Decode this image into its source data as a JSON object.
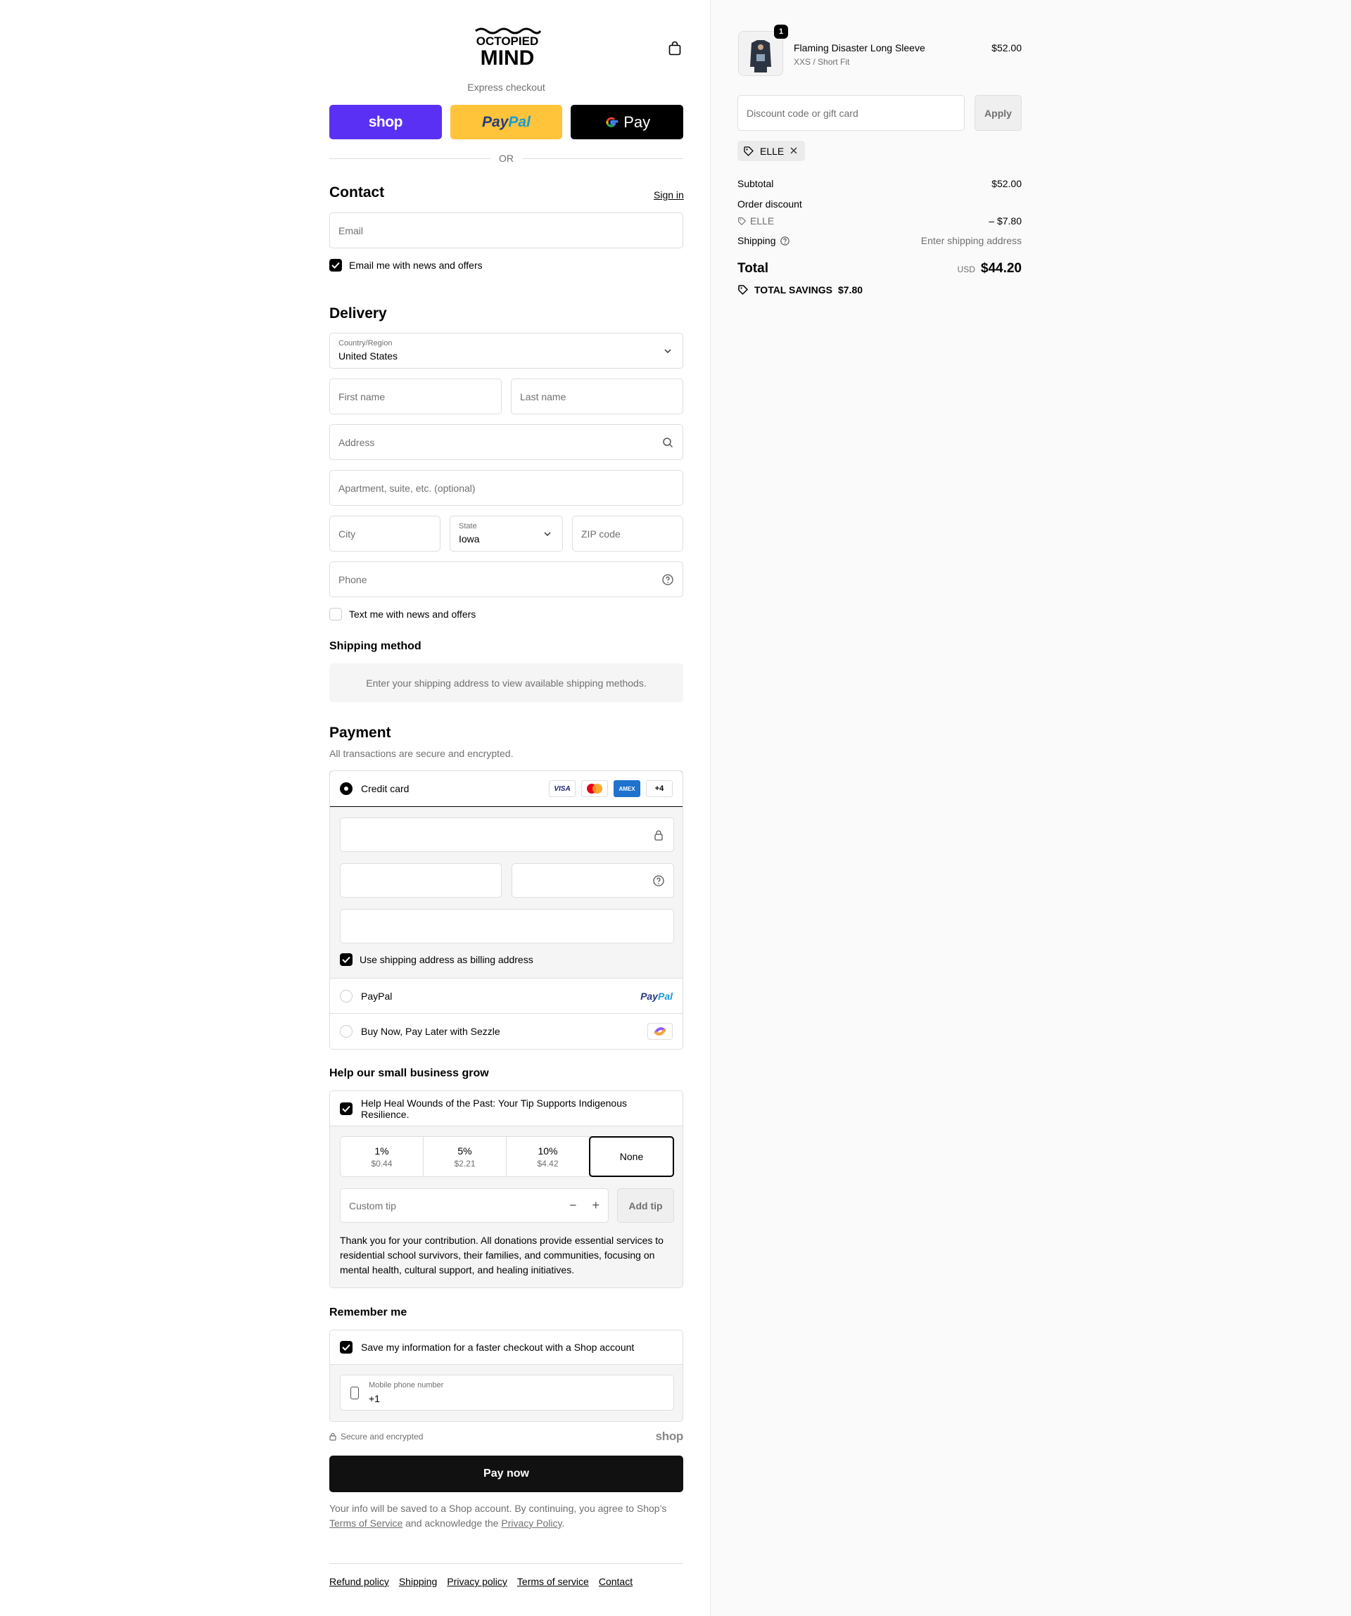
{
  "header": {
    "logo_line1": "OCTOPIED",
    "logo_line2": "MIND",
    "express_label": "Express checkout",
    "express_buttons": {
      "shop": "shop",
      "paypal_1": "Pay",
      "paypal_2": "Pal",
      "gpay": "Pay"
    },
    "or_label": "OR"
  },
  "contact": {
    "title": "Contact",
    "sign_in": "Sign in",
    "email_placeholder": "Email",
    "news_label": "Email me with news and offers",
    "news_checked": true
  },
  "delivery": {
    "title": "Delivery",
    "country_label": "Country/Region",
    "country_value": "United States",
    "first_name_placeholder": "First name",
    "last_name_placeholder": "Last name",
    "address_placeholder": "Address",
    "apartment_placeholder": "Apartment, suite, etc. (optional)",
    "city_placeholder": "City",
    "state_label": "State",
    "state_value": "Iowa",
    "zip_placeholder": "ZIP code",
    "phone_placeholder": "Phone",
    "text_label": "Text me with news and offers",
    "text_checked": false
  },
  "shipping_method": {
    "title": "Shipping method",
    "message": "Enter your shipping address to view available shipping methods."
  },
  "payment": {
    "title": "Payment",
    "subtitle": "All transactions are secure and encrypted.",
    "credit_card_label": "Credit card",
    "card_brands": [
      "VISA",
      "MC",
      "AMEX",
      "+4"
    ],
    "billing_label": "Use shipping address as billing address",
    "billing_checked": true,
    "paypal_label": "PayPal",
    "paypal_logo_1": "Pay",
    "paypal_logo_2": "Pal",
    "sezzle_label": "Buy Now, Pay Later with Sezzle"
  },
  "tip": {
    "title": "Help our small business grow",
    "heading": "Help Heal Wounds of the Past: Your Tip Supports Indigenous Resilience.",
    "heading_checked": true,
    "options": [
      {
        "pct": "1%",
        "amount": "$0.44"
      },
      {
        "pct": "5%",
        "amount": "$2.21"
      },
      {
        "pct": "10%",
        "amount": "$4.42"
      },
      {
        "pct": "None",
        "amount": ""
      }
    ],
    "selected": "None",
    "custom_placeholder": "Custom tip",
    "add_label": "Add tip",
    "note": "Thank you for your contribution. All donations provide essential services to residential school survivors, their families, and communities, focusing on mental health, cultural support, and healing initiatives."
  },
  "remember": {
    "title": "Remember me",
    "save_label": "Save my information for a faster checkout with a Shop account",
    "save_checked": true,
    "phone_label": "Mobile phone number",
    "phone_value": "+1"
  },
  "secure": {
    "label": "Secure and encrypted",
    "shop_word": "shop"
  },
  "pay_now": "Pay now",
  "legal": {
    "text1": "Your info will be saved to a Shop account. By continuing, you agree to Shop’s",
    "terms": "Terms of Service",
    "text2": "and acknowledge the",
    "privacy": "Privacy Policy",
    "text3": "."
  },
  "footer_links": [
    "Refund policy",
    "Shipping",
    "Privacy policy",
    "Terms of service",
    "Contact"
  ],
  "summary": {
    "product_name": "Flaming Disaster Long Sleeve",
    "variant": "XXS / Short Fit",
    "quantity": "1",
    "price": "$52.00",
    "discount_placeholder": "Discount code or gift card",
    "apply_label": "Apply",
    "code_chip": "ELLE",
    "subtotal_label": "Subtotal",
    "subtotal_value": "$52.00",
    "order_discount_label": "Order discount",
    "discount_code": "ELLE",
    "discount_value": "– $7.80",
    "shipping_label": "Shipping",
    "shipping_value": "Enter shipping address",
    "total_label": "Total",
    "currency": "USD",
    "total_value": "$44.20",
    "savings_label": "TOTAL SAVINGS",
    "savings_value": "$7.80"
  }
}
